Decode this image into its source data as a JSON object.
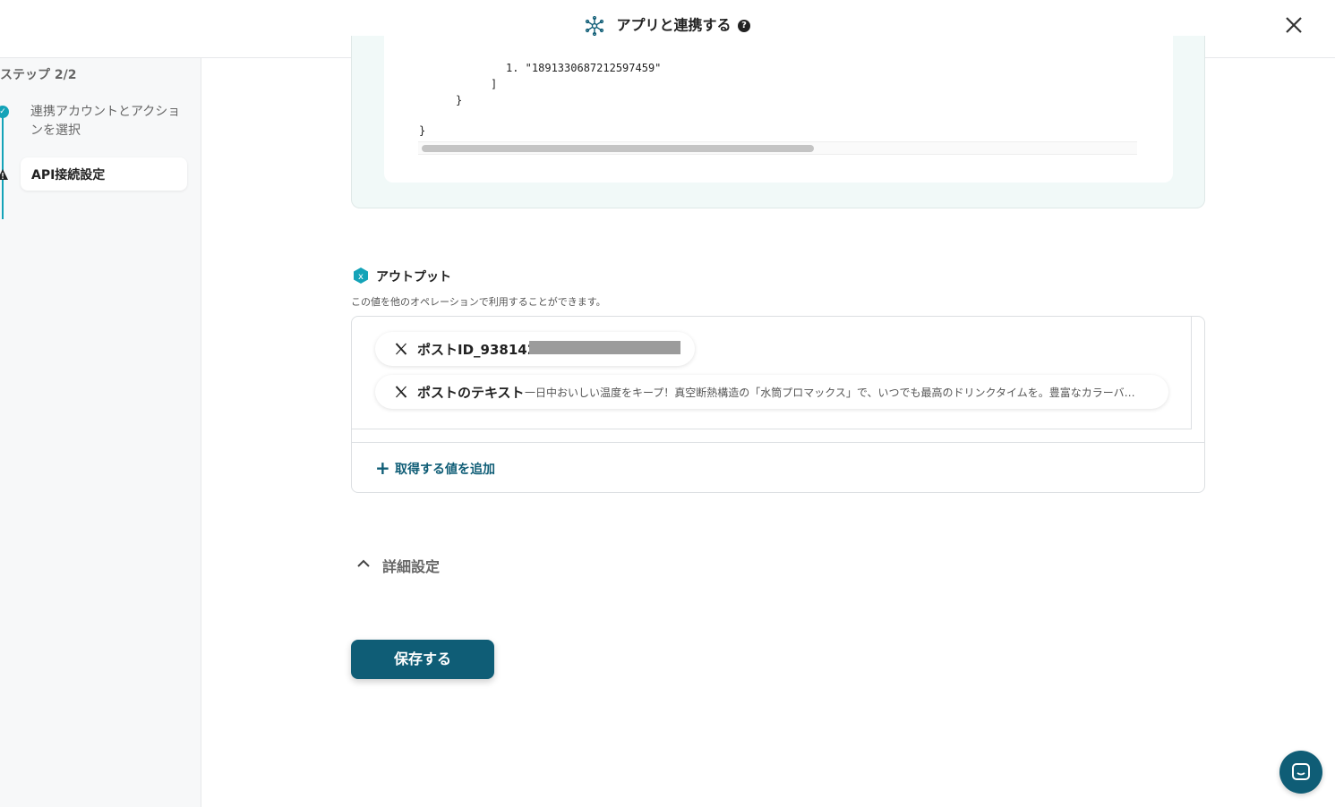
{
  "header": {
    "title": "アプリと連携する",
    "help_glyph": "?",
    "icon": "app-connect-icon",
    "close_icon": "close-icon"
  },
  "sidebar": {
    "step_label": "ステップ 2/2",
    "steps": [
      {
        "label": "連携アカウントとアクションを選択",
        "status": "done"
      },
      {
        "label": "API接続設定",
        "status": "warning",
        "active": true
      }
    ]
  },
  "code": {
    "lines": [
      "1. \"1891330687212597459\"",
      "]",
      "}",
      "}"
    ]
  },
  "output": {
    "title": "アウトプット",
    "description": "この値を他のオペレーションで利用することができます。",
    "items": [
      {
        "label": "ポストID_938142",
        "value": ""
      },
      {
        "label": "ポストのテキスト",
        "value": "一日中おいしい温度をキープ！真空断熱構造の「水筒プロマックス」で、いつでも最高のドリンクタイムを。豊富なカラーバリエーション"
      }
    ],
    "add_label": "取得する値を追加"
  },
  "detail": {
    "label": "詳細設定"
  },
  "save": {
    "label": "保存する"
  },
  "colors": {
    "accent": "#14a3b8",
    "primary": "#0f5d76",
    "code_bg": "#f1f9f8"
  }
}
